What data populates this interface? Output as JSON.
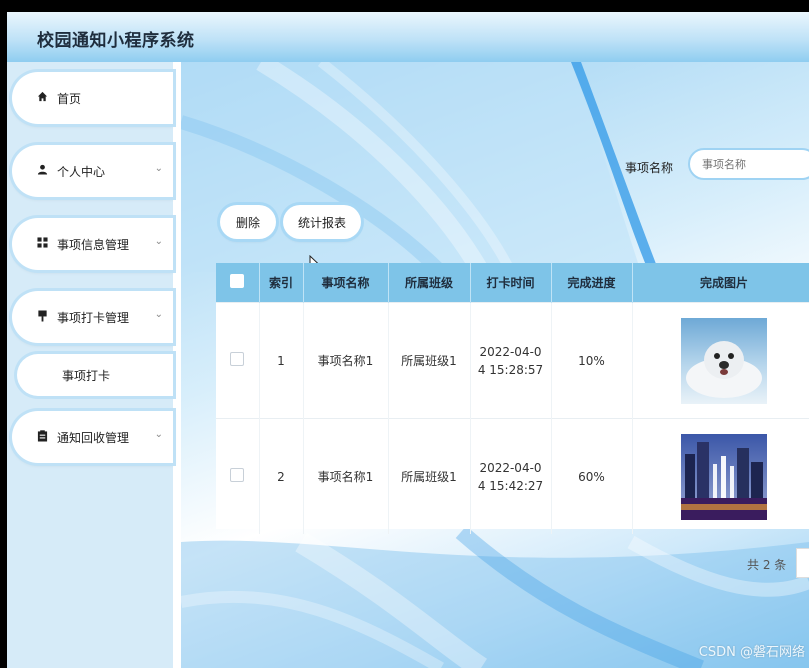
{
  "app": {
    "title": "校园通知小程序系统"
  },
  "sidebar": {
    "items": [
      {
        "label": "首页",
        "icon": "home-icon"
      },
      {
        "label": "个人中心",
        "icon": "user-icon"
      },
      {
        "label": "事项信息管理",
        "icon": "grid-icon"
      },
      {
        "label": "事项打卡管理",
        "icon": "pin-icon"
      },
      {
        "label": "通知回收管理",
        "icon": "clipboard-icon"
      }
    ],
    "subitem": {
      "label": "事项打卡"
    }
  },
  "search": {
    "label": "事项名称",
    "placeholder": "事项名称"
  },
  "toolbar": {
    "delete_label": "删除",
    "report_label": "统计报表"
  },
  "table": {
    "columns": [
      "索引",
      "事项名称",
      "所属班级",
      "打卡时间",
      "完成进度",
      "完成图片"
    ],
    "rows": [
      {
        "index": "1",
        "name": "事项名称1",
        "class": "所属班级1",
        "time_line1": "2022-04-0",
        "time_line2": "4 15:28:57",
        "progress": "10%",
        "image": "seal-photo"
      },
      {
        "index": "2",
        "name": "事项名称1",
        "class": "所属班级1",
        "time_line1": "2022-04-0",
        "time_line2": "4 15:42:27",
        "progress": "60%",
        "image": "city-fountain-photo"
      }
    ]
  },
  "pagination": {
    "total": "共 2 条"
  },
  "watermark": "CSDN @磐石网络",
  "colors": {
    "header_accent": "#8fcdf0",
    "table_header": "#7ec4e8",
    "sidebar_bg": "#d6ebf8"
  }
}
